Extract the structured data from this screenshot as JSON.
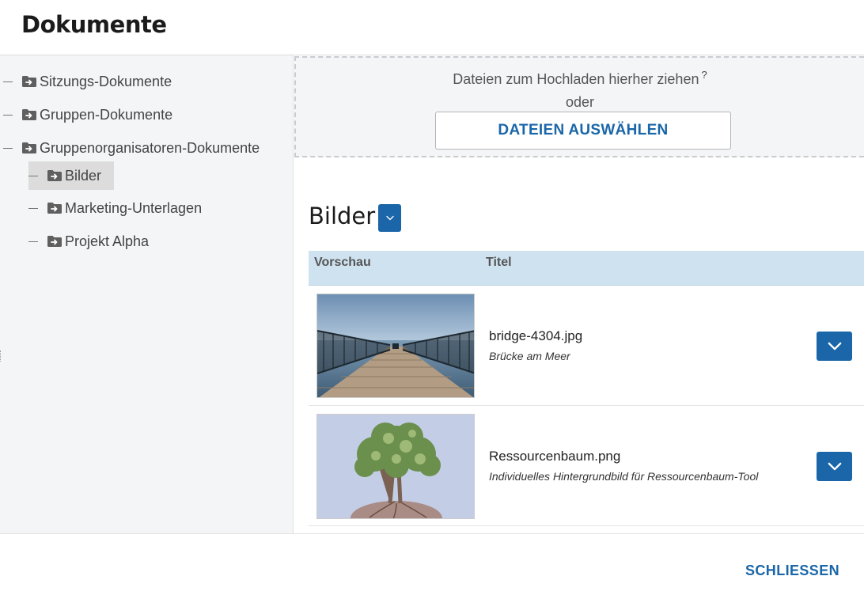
{
  "dialog": {
    "title": "Dokumente"
  },
  "tree": {
    "items": [
      {
        "label": "Sitzungs-Dokumente",
        "icon": "folder-arrow-icon",
        "level": 0,
        "selected": false
      },
      {
        "label": "Gruppen-Dokumente",
        "icon": "folder-arrow-icon",
        "level": 0,
        "selected": false
      },
      {
        "label": "Gruppenorganisatoren-Dokumente",
        "icon": "folder-arrow-icon",
        "level": 0,
        "selected": false
      },
      {
        "label": "Bilder",
        "icon": "folder-arrow-icon",
        "level": 1,
        "selected": true
      },
      {
        "label": "Marketing-Unterlagen",
        "icon": "folder-arrow-icon",
        "level": 1,
        "selected": false
      },
      {
        "label": "Projekt Alpha",
        "icon": "folder-arrow-icon",
        "level": 1,
        "selected": false
      }
    ]
  },
  "upload": {
    "drag_text": "Dateien zum Hochladen hierher ziehen",
    "help": "?",
    "or_text": "oder",
    "button_label": "DATEIEN AUSWÄHLEN"
  },
  "folder": {
    "title": "Bilder",
    "dropdown_icon": "chevron-down-icon"
  },
  "table": {
    "columns": [
      "Vorschau",
      "Titel"
    ],
    "rows": [
      {
        "filename": "bridge-4304.jpg",
        "description": "Brücke am Meer",
        "preview": "bridge-photo",
        "menu_icon": "chevron-down-icon"
      },
      {
        "filename": "Ressourcenbaum.png",
        "description": "Individuelles Hintergrundbild für Ressourcenbaum-Tool",
        "preview": "tree-illustration",
        "menu_icon": "chevron-down-icon"
      }
    ]
  },
  "footer": {
    "close_label": "SCHLIESSEN"
  },
  "colors": {
    "accent": "#1a66a8",
    "sidebar_bg": "#f4f5f6",
    "table_header_bg": "#cfe2f0",
    "selected_bg": "#dcdcdc"
  }
}
